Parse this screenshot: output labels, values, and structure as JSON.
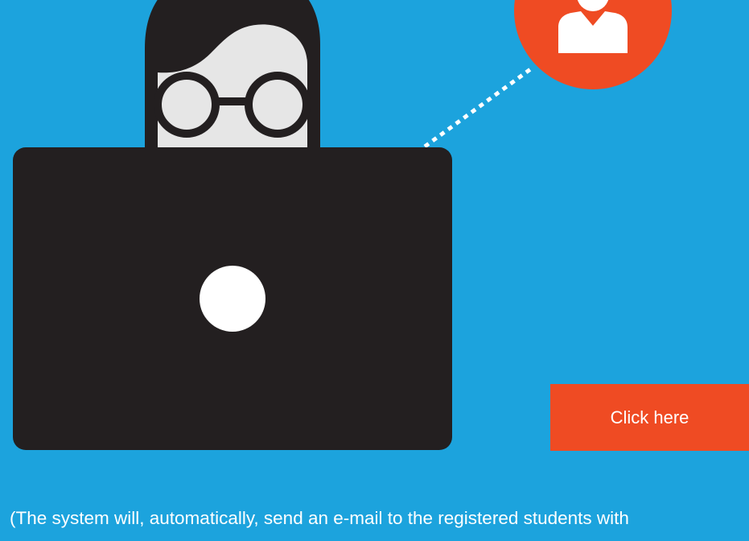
{
  "colors": {
    "background": "#1ca3dd",
    "accent": "#ef4b23",
    "laptop": "#231f20",
    "hair": "#231f20",
    "face": "#e6e6e6",
    "white": "#ffffff"
  },
  "illustration": {
    "person": "person-with-glasses-icon",
    "laptop": "laptop-icon",
    "logo": "laptop-logo-icon",
    "avatar": "user-avatar-icon",
    "connector": "dotted-connector-line"
  },
  "cta": {
    "label": "Click here"
  },
  "note": {
    "text": "(The system will, automatically, send an e-mail to the registered students with"
  }
}
